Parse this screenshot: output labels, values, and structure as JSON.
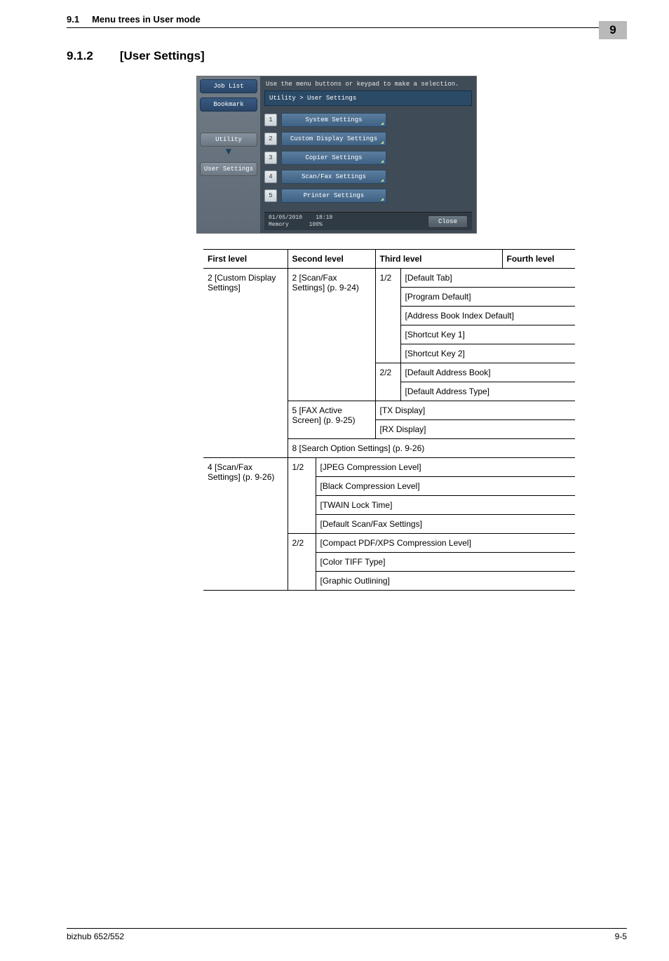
{
  "header": {
    "section_num": "9.1",
    "section_title": "Menu trees in User mode",
    "page_badge": "9"
  },
  "heading": {
    "num": "9.1.2",
    "text": "[User Settings]"
  },
  "screenshot": {
    "left_tabs": {
      "job_list": "Job List",
      "bookmark": "Bookmark",
      "utility": "Utility",
      "user_settings": "User Settings"
    },
    "instruction": "Use the menu buttons or keypad to make a selection.",
    "breadcrumb": "Utility > User Settings",
    "buttons": [
      {
        "n": "1",
        "label": "System Settings"
      },
      {
        "n": "2",
        "label": "Custom Display Settings"
      },
      {
        "n": "3",
        "label": "Copier Settings"
      },
      {
        "n": "4",
        "label": "Scan/Fax Settings"
      },
      {
        "n": "5",
        "label": "Printer Settings"
      }
    ],
    "status_date": "01/05/2010",
    "status_time": "18:19",
    "status_mem_label": "Memory",
    "status_mem_val": "100%",
    "close": "Close"
  },
  "table": {
    "headers": {
      "c1": "First level",
      "c2": "Second level",
      "c3": "Third level",
      "c4": "Fourth level"
    },
    "r1c1": "2 [Custom Display Settings]",
    "r1c2": "2 [Scan/Fax Settings] (p. 9-24)",
    "r1p": "1/2",
    "l_default_tab": "[Default Tab]",
    "l_program_default": "[Program Default]",
    "l_abid": "[Address Book Index Default]",
    "l_sk1": "[Shortcut Key 1]",
    "l_sk2": "[Shortcut Key 2]",
    "r6p": "2/2",
    "l_dab": "[Default Address Book]",
    "l_dat": "[Default Address Type]",
    "r2c2": "5 [FAX Active Screen] (p. 9-25)",
    "l_tx": "[TX Display]",
    "l_rx": "[RX Display]",
    "r_search": "8 [Search Option Settings] (p. 9-26)",
    "r3c1": "4 [Scan/Fax Settings] (p. 9-26)",
    "r3p1": "1/2",
    "l_jpeg": "[JPEG Compression Level]",
    "l_black": "[Black Compression Level]",
    "l_twain": "[TWAIN Lock Time]",
    "l_dsfs": "[Default Scan/Fax Settings]",
    "r3p2": "2/2",
    "l_cpx": "[Compact PDF/XPS Compression Level]",
    "l_ctt": "[Color TIFF Type]",
    "l_go": "[Graphic Outlining]"
  },
  "footer": {
    "left": "bizhub 652/552",
    "right": "9-5"
  }
}
